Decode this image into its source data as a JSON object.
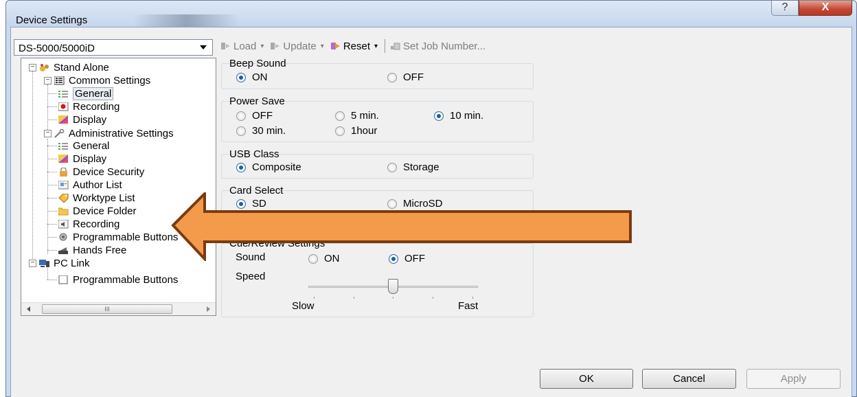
{
  "window": {
    "title": "Device Settings",
    "help_glyph": "?",
    "close_glyph": "X"
  },
  "device_select": {
    "value": "DS-5000/5000iD"
  },
  "toolbar": {
    "load": "Load",
    "update": "Update",
    "reset": "Reset",
    "set_job_number": "Set Job Number..."
  },
  "tree": {
    "items": [
      {
        "label": "Stand Alone",
        "icon": "gear-cluster-icon"
      },
      {
        "label": "Common Settings",
        "icon": "list-icon"
      },
      {
        "label": "General",
        "icon": "general-list-icon"
      },
      {
        "label": "Recording",
        "icon": "recording-dot-icon"
      },
      {
        "label": "Display",
        "icon": "display-icon"
      },
      {
        "label": "Administrative Settings",
        "icon": "wrench-icon"
      },
      {
        "label": "General",
        "icon": "general-list-icon"
      },
      {
        "label": "Display",
        "icon": "display-icon"
      },
      {
        "label": "Device Security",
        "icon": "lock-icon"
      },
      {
        "label": "Author List",
        "icon": "card-icon"
      },
      {
        "label": "Worktype List",
        "icon": "tag-icon"
      },
      {
        "label": "Device Folder",
        "icon": "folder-icon"
      },
      {
        "label": "Recording",
        "icon": "speaker-icon"
      },
      {
        "label": "Programmable Buttons",
        "icon": "button-icon"
      },
      {
        "label": "Hands Free",
        "icon": "pedal-icon"
      },
      {
        "label": "PC Link",
        "icon": "pc-icon"
      },
      {
        "label": "Programmable Buttons",
        "icon": "checkbox-icon"
      }
    ],
    "scroll_grip": "III"
  },
  "beep_sound": {
    "title": "Beep Sound",
    "on": "ON",
    "off": "OFF",
    "selected": "ON"
  },
  "power_save": {
    "title": "Power Save",
    "off": "OFF",
    "5min": "5 min.",
    "10min": "10 min.",
    "30min": "30 min.",
    "1hour": "1hour",
    "selected": "10 min."
  },
  "usb_class": {
    "title": "USB Class",
    "composite": "Composite",
    "storage": "Storage",
    "selected": "Composite"
  },
  "card_select": {
    "title": "Card Select",
    "sd": "SD",
    "microsd": "MicroSD",
    "selected": "SD"
  },
  "cue_review": {
    "title": "Cue/Review Settings",
    "sound_label": "Sound",
    "sound_on": "ON",
    "sound_off": "OFF",
    "sound_selected": "OFF",
    "speed_label": "Speed",
    "slow": "Slow",
    "fast": "Fast",
    "speed_level": 0.5
  },
  "buttons": {
    "ok": "OK",
    "cancel": "Cancel",
    "apply": "Apply"
  },
  "colors": {
    "arrow_fill": "#f49a4b",
    "arrow_border": "#7a3b10",
    "title_bar": "#c6d6ec",
    "close_red": "#c54632"
  }
}
